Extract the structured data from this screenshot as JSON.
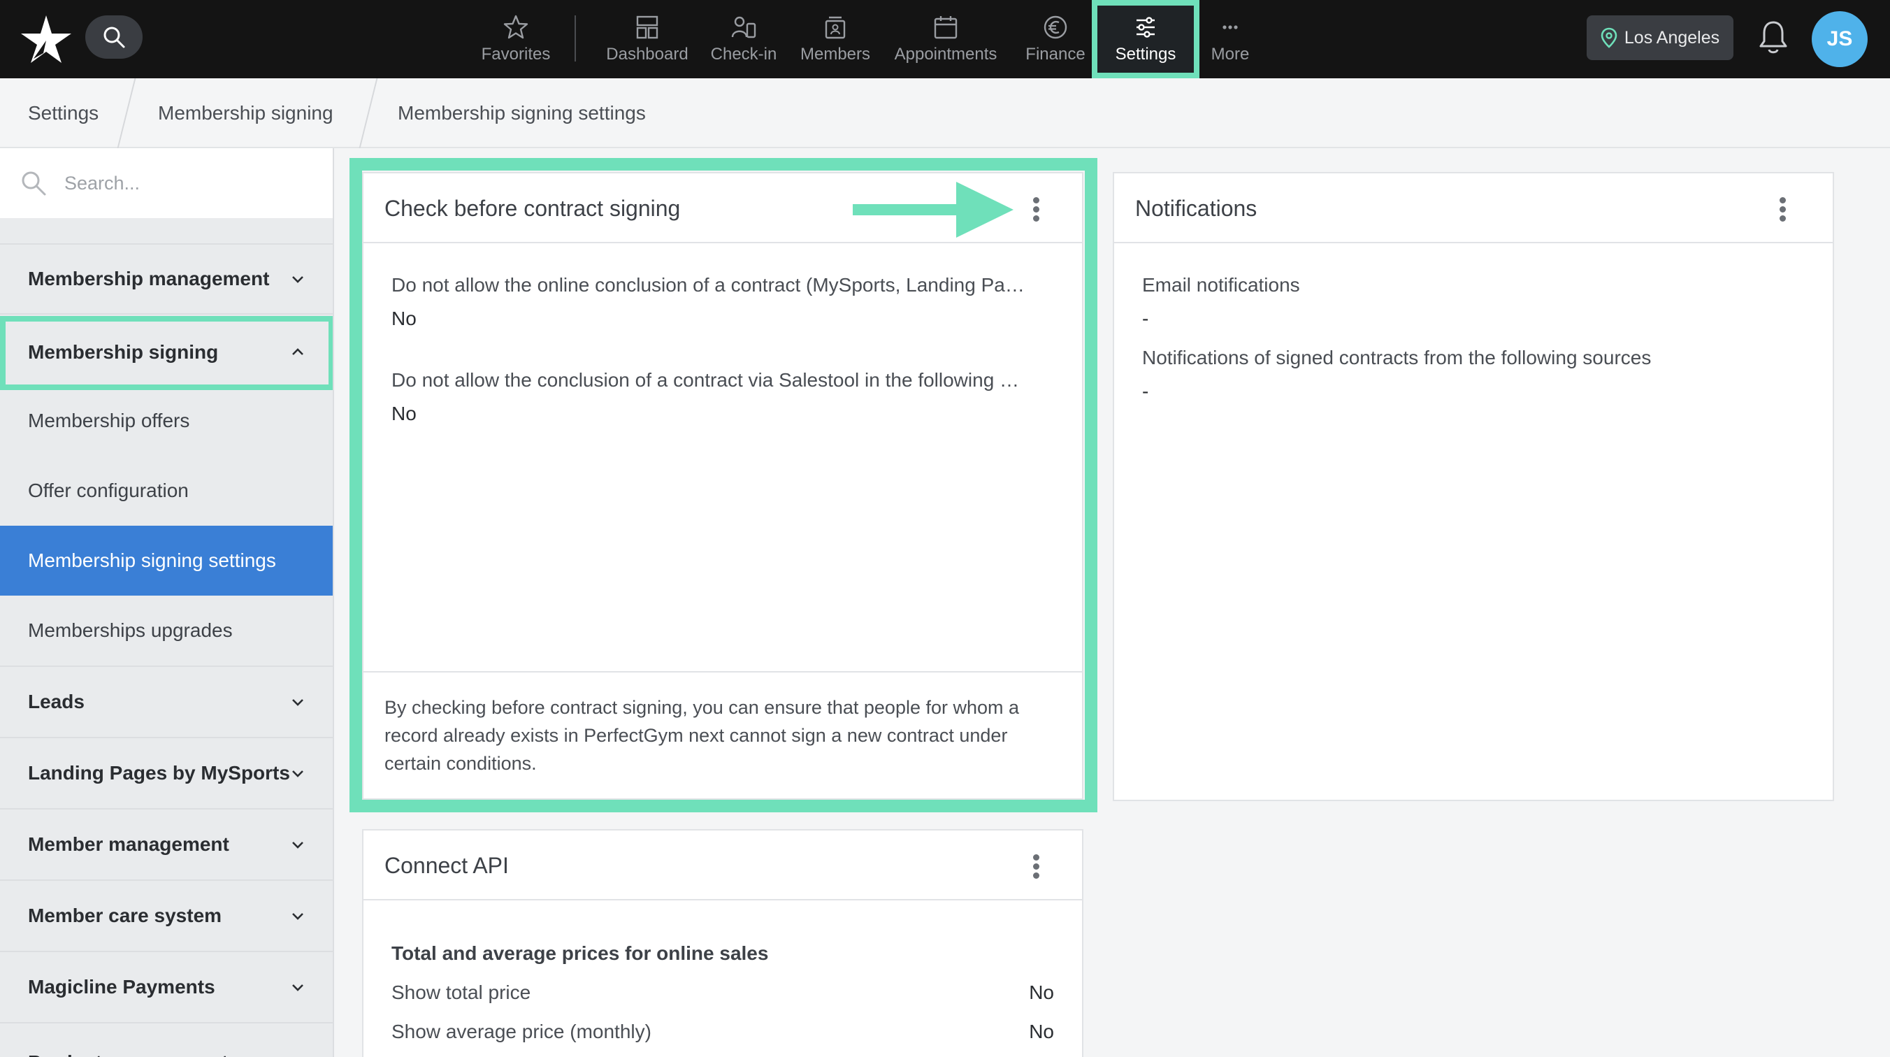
{
  "topnav": {
    "items": [
      {
        "label": "Favorites",
        "icon": "star-icon"
      },
      {
        "label": "Dashboard",
        "icon": "dashboard-icon"
      },
      {
        "label": "Check-in",
        "icon": "check-in-icon"
      },
      {
        "label": "Members",
        "icon": "members-icon"
      },
      {
        "label": "Appointments",
        "icon": "calendar-icon"
      },
      {
        "label": "Finance",
        "icon": "euro-icon"
      },
      {
        "label": "Settings",
        "icon": "sliders-icon"
      },
      {
        "label": "More",
        "icon": "more-icon"
      }
    ],
    "active": "Settings",
    "location": "Los Angeles",
    "avatar_initials": "JS"
  },
  "breadcrumb": [
    "Settings",
    "Membership signing",
    "Membership signing settings"
  ],
  "sidebar": {
    "search_placeholder": "Search...",
    "items": [
      {
        "label": "Membership management",
        "type": "group",
        "expanded": false
      },
      {
        "label": "Membership signing",
        "type": "group",
        "expanded": true
      },
      {
        "label": "Membership offers",
        "type": "sub"
      },
      {
        "label": "Offer configuration",
        "type": "sub"
      },
      {
        "label": "Membership signing settings",
        "type": "sub",
        "active": true
      },
      {
        "label": "Memberships upgrades",
        "type": "sub"
      },
      {
        "label": "Leads",
        "type": "group",
        "expanded": false
      },
      {
        "label": "Landing Pages by MySports",
        "type": "group",
        "expanded": false
      },
      {
        "label": "Member management",
        "type": "group",
        "expanded": false
      },
      {
        "label": "Member care system",
        "type": "group",
        "expanded": false
      },
      {
        "label": "Magicline Payments",
        "type": "group",
        "expanded": false
      },
      {
        "label": "Product management",
        "type": "group",
        "expanded": false
      }
    ]
  },
  "cards": {
    "check": {
      "title": "Check before contract signing",
      "rows": [
        {
          "label": "Do not allow the online conclusion of a contract (MySports, Landing Pa…",
          "value": "No"
        },
        {
          "label": "Do not allow the conclusion of a contract via Salestool in the following …",
          "value": "No"
        }
      ],
      "footer": "By checking before contract signing, you can ensure that people for whom a record already exists in PerfectGym next cannot sign a new contract under certain conditions."
    },
    "notifications": {
      "title": "Notifications",
      "rows": [
        {
          "label": "Email notifications",
          "value": "-"
        },
        {
          "label": "Notifications of signed contracts from the following sources",
          "value": "-"
        }
      ]
    },
    "api": {
      "title": "Connect API",
      "section_title": "Total and average prices for online sales",
      "rows": [
        {
          "label": "Show total price",
          "value": "No"
        },
        {
          "label": "Show average price (monthly)",
          "value": "No"
        }
      ]
    }
  },
  "colors": {
    "highlight": "#6fe0ba",
    "active_blue": "#3a7fd6",
    "topbar": "#141414"
  }
}
